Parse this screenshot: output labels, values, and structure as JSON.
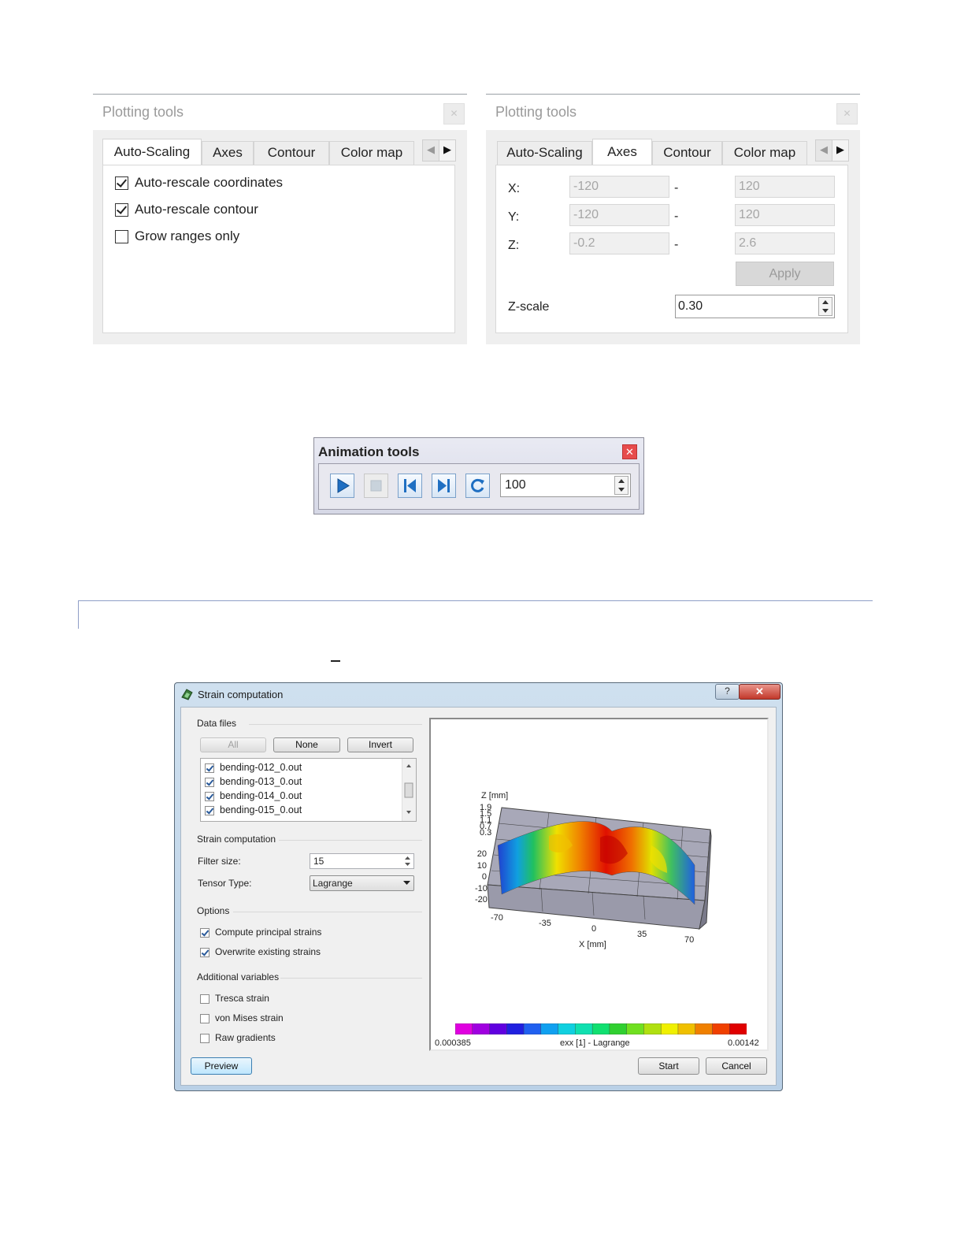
{
  "plotting_left": {
    "title": "Plotting tools",
    "tabs": [
      "Auto-Scaling",
      "Axes",
      "Contour",
      "Color map"
    ],
    "active_tab": "Auto-Scaling",
    "options": [
      {
        "label": "Auto-rescale coordinates",
        "checked": true
      },
      {
        "label": "Auto-rescale contour",
        "checked": true
      },
      {
        "label": "Grow ranges only",
        "checked": false
      }
    ]
  },
  "plotting_right": {
    "title": "Plotting tools",
    "tabs": [
      "Auto-Scaling",
      "Axes",
      "Contour",
      "Color map"
    ],
    "active_tab": "Axes",
    "axes": [
      {
        "label": "X:",
        "min": "-120",
        "sep": "-",
        "max": "120"
      },
      {
        "label": "Y:",
        "min": "-120",
        "sep": "-",
        "max": "120"
      },
      {
        "label": "Z:",
        "min": "-0.2",
        "sep": "-",
        "max": "2.6"
      }
    ],
    "apply_label": "Apply",
    "zscale_label": "Z-scale",
    "zscale_value": "0.30"
  },
  "animation": {
    "title": "Animation tools",
    "close_glyph": "✕",
    "buttons": [
      "play-icon",
      "stop-icon",
      "first-frame-icon",
      "last-frame-icon",
      "loop-icon"
    ],
    "value": "100"
  },
  "strain": {
    "title": "Strain computation",
    "help_glyph": "?",
    "close_glyph": "✕",
    "data_files_title": "Data files",
    "btn_all": "All",
    "btn_none": "None",
    "btn_invert": "Invert",
    "files": [
      {
        "name": "bending-012_0.out",
        "checked": true
      },
      {
        "name": "bending-013_0.out",
        "checked": true
      },
      {
        "name": "bending-014_0.out",
        "checked": true
      },
      {
        "name": "bending-015_0.out",
        "checked": true
      }
    ],
    "strain_title": "Strain computation",
    "filter_label": "Filter size:",
    "filter_value": "15",
    "tensor_label": "Tensor Type:",
    "tensor_value": "Lagrange",
    "options_title": "Options",
    "options": [
      {
        "label": "Compute principal strains",
        "checked": true
      },
      {
        "label": "Overwrite existing strains",
        "checked": true
      }
    ],
    "additional_title": "Additional variables",
    "additional": [
      {
        "label": "Tresca strain",
        "checked": false
      },
      {
        "label": "von Mises strain",
        "checked": false
      },
      {
        "label": "Raw gradients",
        "checked": false
      }
    ],
    "btn_preview": "Preview",
    "btn_start": "Start",
    "btn_cancel": "Cancel",
    "plot": {
      "z_axis_label": "Z [mm]",
      "z_ticks_top": [
        "1.9",
        "1.5",
        "1.1",
        "0.7",
        "0.3"
      ],
      "y_ticks": [
        "20",
        "10",
        "0",
        "-10",
        "-20"
      ],
      "x_ticks": [
        "-70",
        "-35",
        "0",
        "35",
        "70"
      ],
      "x_axis_label": "X [mm]",
      "colorbar_min": "0.000385",
      "colorbar_max": "0.00142",
      "colorbar_label": "exx [1] - Lagrange",
      "colorbar_colors": [
        "#e000e0",
        "#a000e0",
        "#6000e0",
        "#2020e0",
        "#2060f0",
        "#10a0f0",
        "#10d0e0",
        "#10e0b0",
        "#10e070",
        "#30d030",
        "#70e020",
        "#b0e010",
        "#f0f000",
        "#f0c000",
        "#f08000",
        "#f04000",
        "#e00000"
      ]
    }
  }
}
